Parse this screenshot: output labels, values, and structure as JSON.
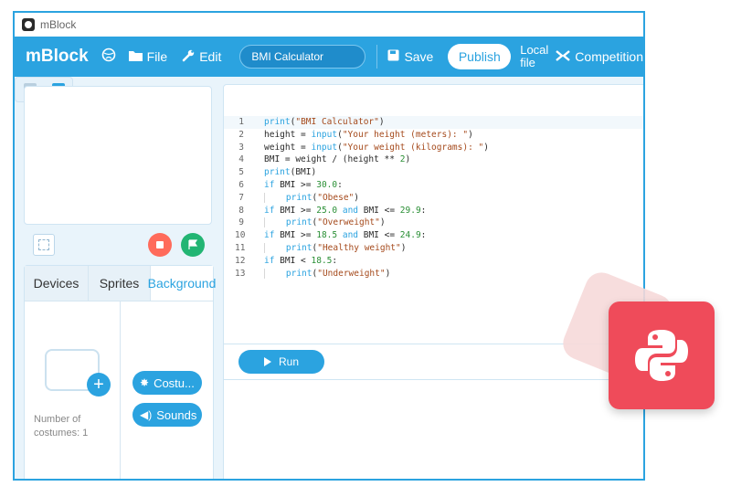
{
  "window": {
    "title": "mBlock"
  },
  "menubar": {
    "brand": "mBlock",
    "file_label": "File",
    "edit_label": "Edit",
    "project_name": "BMI Calculator",
    "save_label": "Save",
    "publish_label": "Publish",
    "local_file_line1": "Local",
    "local_file_line2": "file",
    "competition_label": "Competition"
  },
  "tabs": [
    {
      "label": "Devices"
    },
    {
      "label": "Sprites"
    },
    {
      "label": "Background"
    }
  ],
  "costumes": {
    "count_line1": "Number of",
    "count_line2": "costumes: 1",
    "costume_button": "Costu...",
    "sounds_button": "Sounds"
  },
  "editor": {
    "line_numbers": [
      "1",
      "2",
      "3",
      "4",
      "5",
      "6",
      "7",
      "8",
      "9",
      "10",
      "11",
      "12",
      "13"
    ],
    "run_label": "Run"
  },
  "code_lines": [
    "print(\"BMI Calculator\")",
    "height = input(\"Your height (meters): \")",
    "weight = input(\"Your weight (kilograms): \")",
    "BMI = weight / (height ** 2)",
    "print(BMI)",
    "if BMI >= 30.0:",
    "    print(\"Obese\")",
    "if BMI >= 25.0 and BMI <= 29.9:",
    "    print(\"Overweight\")",
    "if BMI >= 18.5 and BMI <= 24.9:",
    "    print(\"Healthy weight\")",
    "if BMI < 18.5:",
    "    print(\"Underweight\")"
  ],
  "colors": {
    "accent": "#2ba3e0",
    "stop": "#ff6b5b",
    "go": "#22b573",
    "python_badge": "#ef4b5a"
  },
  "icons": {
    "globe": "globe-icon",
    "file": "folder-icon",
    "edit": "wrench-icon",
    "save": "save-icon",
    "competition": "competition-icon",
    "python": "python-logo-icon"
  }
}
